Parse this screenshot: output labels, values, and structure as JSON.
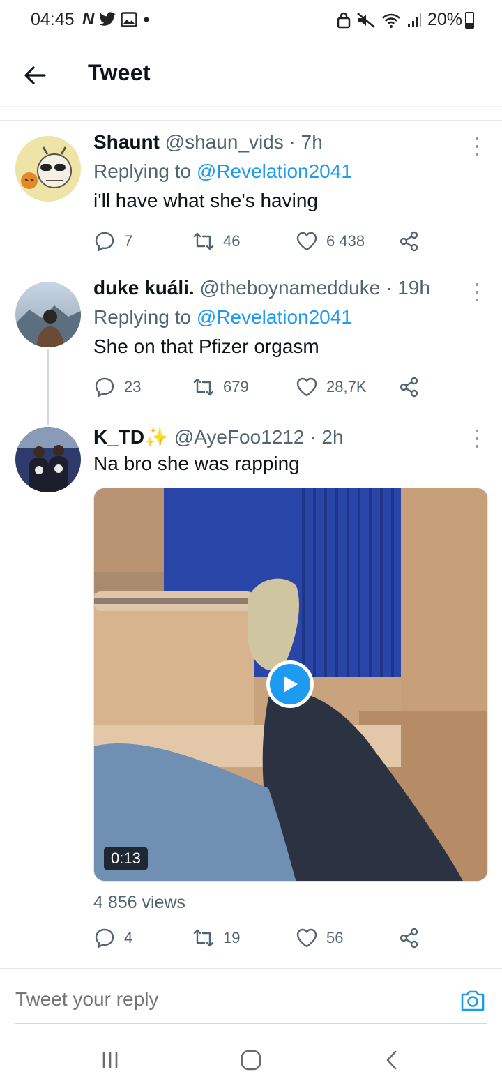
{
  "status_bar": {
    "time": "04:45",
    "left_icons": [
      "netflix-icon",
      "twitter-icon",
      "gallery-icon",
      "dot-icon"
    ],
    "right_icons": [
      "lock-icon",
      "mute-icon",
      "wifi-icon",
      "signal-icon"
    ],
    "battery": "20%"
  },
  "header": {
    "title": "Tweet"
  },
  "tweets": [
    {
      "name": "Shaunt",
      "handle": "@shaun_vids",
      "time": "· 7h",
      "replying_prefix": "Replying to ",
      "replying_to": "@Revelation2041",
      "text": "i'll have what she's having",
      "replies": "7",
      "retweets": "46",
      "likes": "6 438"
    },
    {
      "name": "duke kuáli.",
      "handle": "@theboynamedduke",
      "time": "· 19h",
      "replying_prefix": "Replying to ",
      "replying_to": "@Revelation2041",
      "text": "She on that Pfizer orgasm",
      "replies": "23",
      "retweets": "679",
      "likes": "28,7K"
    },
    {
      "name": "K_TD",
      "name_emoji": "✨",
      "handle": "@AyeFoo1212",
      "time": "· 2h",
      "text": "Na bro she was rapping",
      "video_duration": "0:13",
      "views": "4 856 views",
      "replies": "4",
      "retweets": "19",
      "likes": "56"
    }
  ],
  "reply_bar": {
    "placeholder": "Tweet your reply"
  },
  "colors": {
    "accent": "#1d9bf0",
    "secondary_text": "#536471",
    "primary_text": "#0f1419"
  }
}
